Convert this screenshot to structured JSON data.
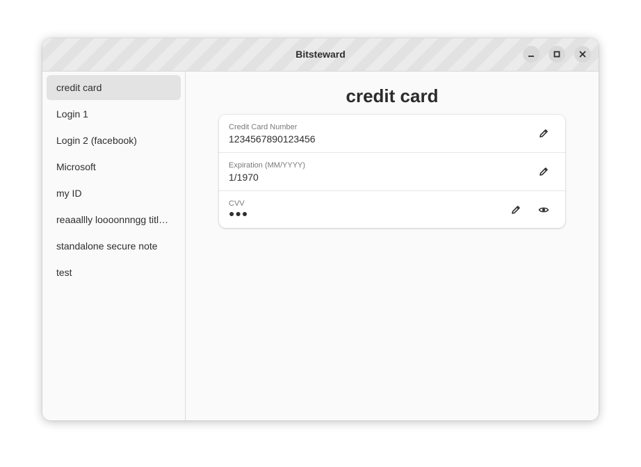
{
  "window": {
    "title": "Bitsteward",
    "controls": {
      "minimize": "minimize-icon",
      "maximize": "maximize-icon",
      "close": "close-icon"
    }
  },
  "sidebar": {
    "items": [
      {
        "label": "credit card",
        "selected": true
      },
      {
        "label": "Login 1"
      },
      {
        "label": "Login 2 (facebook)"
      },
      {
        "label": "Microsoft"
      },
      {
        "label": "my ID"
      },
      {
        "label": "reaaallly loooonnngg title ..."
      },
      {
        "label": "standalone secure note"
      },
      {
        "label": "test"
      }
    ]
  },
  "main": {
    "title": "credit card",
    "fields": [
      {
        "label": "Credit Card Number",
        "value": "1234567890123456",
        "icon": "pencil-icon"
      },
      {
        "label": "Expiration (MM/YYYY)",
        "value": "1/1970",
        "icon": "pencil-icon"
      },
      {
        "label": "CVV",
        "value": "●●●",
        "icons": [
          "pencil-icon",
          "eye-icon"
        ]
      }
    ]
  },
  "colors": {
    "selected_bg": "#e3e3e3",
    "text": "#2e2e2e",
    "label": "#7a7a7a"
  }
}
